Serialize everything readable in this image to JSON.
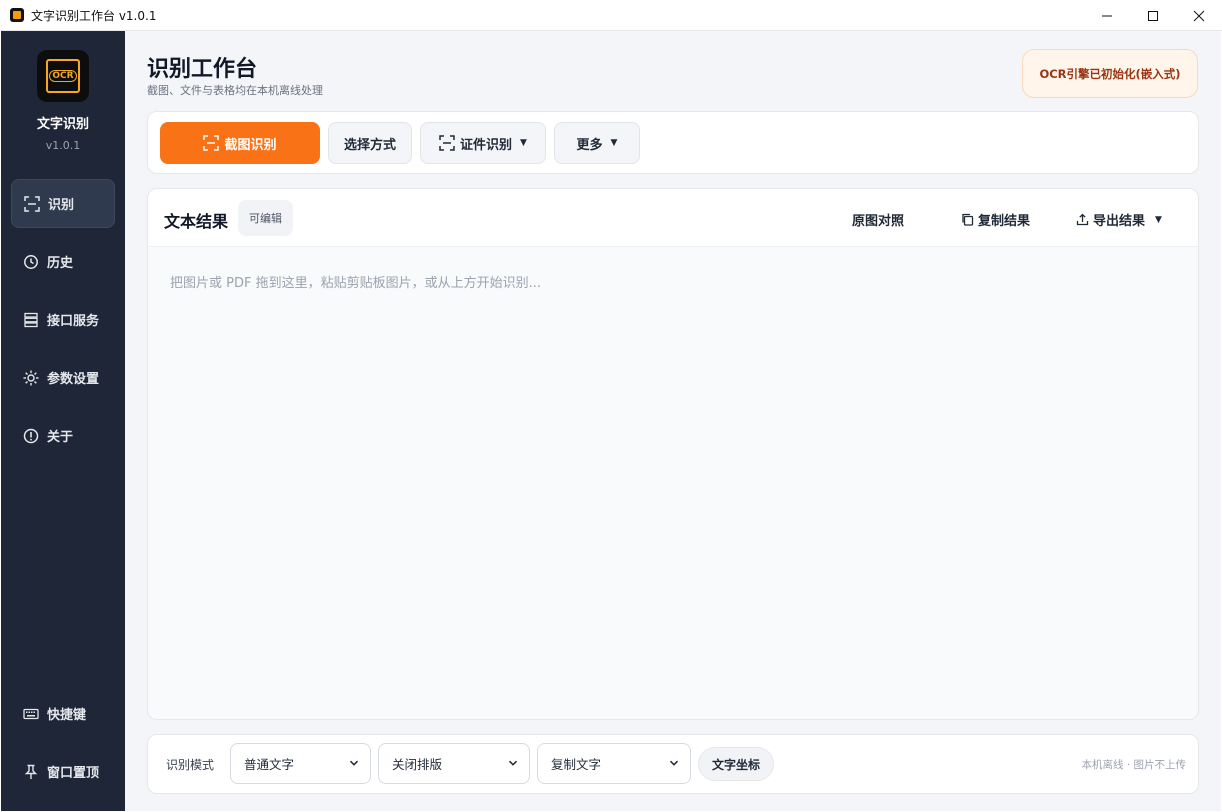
{
  "window": {
    "title": "文字识别工作台 v1.0.1",
    "controls": [
      "minimize",
      "maximize",
      "close"
    ]
  },
  "sidebar": {
    "logo_text": "OCR",
    "app_name": "文字识别",
    "version": "v1.0.1",
    "nav": [
      {
        "label": "识别",
        "icon": "scan-icon",
        "active": true
      },
      {
        "label": "历史",
        "icon": "history-icon",
        "active": false
      },
      {
        "label": "接口服务",
        "icon": "server-icon",
        "active": false
      },
      {
        "label": "参数设置",
        "icon": "gear-icon",
        "active": false
      },
      {
        "label": "关于",
        "icon": "info-icon",
        "active": false
      }
    ],
    "bottom": [
      {
        "label": "快捷键",
        "icon": "keyboard-icon"
      },
      {
        "label": "窗口置顶",
        "icon": "pin-icon"
      }
    ]
  },
  "header": {
    "title": "识别工作台",
    "subtitle": "截图、文件与表格均在本机离线处理",
    "status": "OCR引擎已初始化(嵌入式)"
  },
  "toolbar": {
    "capture": "截图识别",
    "select_method": "选择方式",
    "id_recognition": "证件识别",
    "more": "更多"
  },
  "result": {
    "title": "文本结果",
    "badge": "可编辑",
    "compare": "原图对照",
    "copy": "复制结果",
    "export": "导出结果",
    "placeholder": "把图片或 PDF 拖到这里，粘贴剪贴板图片，或从上方开始识别..."
  },
  "bottom": {
    "mode_label": "识别模式",
    "mode_value": "普通文字",
    "layout_value": "关闭排版",
    "copy_value": "复制文字",
    "coords": "文字坐标",
    "note": "本机离线 · 图片不上传"
  },
  "colors": {
    "accent": "#f97316",
    "sidebar_bg": "#1e2637",
    "status_text": "#9a3412"
  }
}
